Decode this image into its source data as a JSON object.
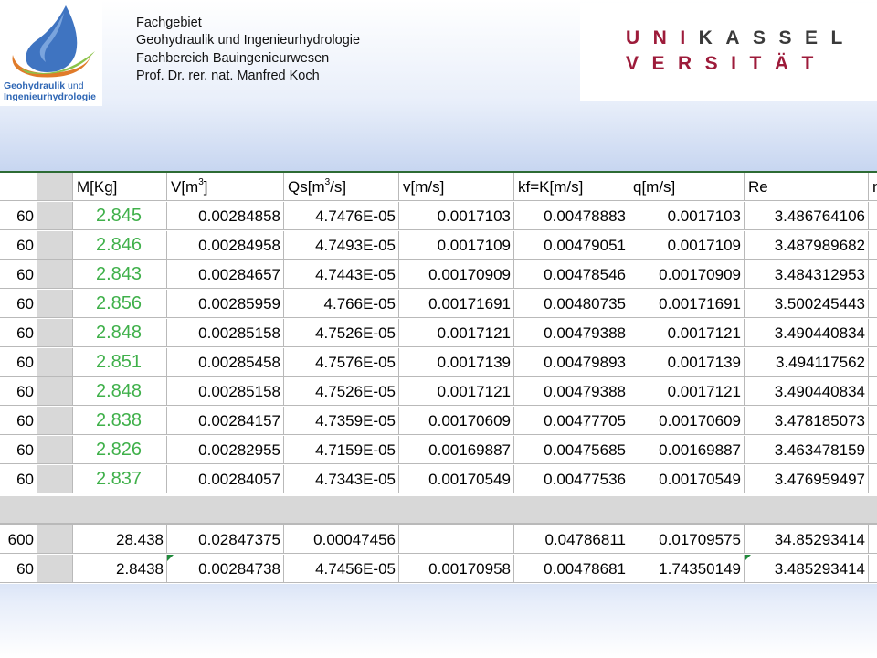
{
  "header": {
    "logo_line1": "Geohydraulik",
    "logo_line1_suffix": "und",
    "logo_line2": "Ingenieurhydrologie",
    "dept_lines": [
      "Fachgebiet",
      "Geohydraulik und Ingenieurhydrologie",
      "Fachbereich Bauingenieurwesen",
      "Prof. Dr. rer. nat. Manfred Koch"
    ],
    "uni_row1_red": "UNI",
    "uni_row1_dark": "KASSEL",
    "uni_row2_red": "VERSITÄT"
  },
  "colors": {
    "logo_blue": "#3f74c1",
    "logo_orange": "#e07b2a",
    "logo_green": "#8bc34a",
    "uni_red": "#9d1b3a",
    "value_green": "#3fb04a"
  },
  "table": {
    "headers": [
      "",
      "",
      "M[Kg]",
      "V[m",
      "]",
      "Qs[m",
      "/s]",
      "v[m/s]",
      "kf=K[m/s]",
      "q[m/s]",
      "Re",
      "n"
    ],
    "header_sup": "3",
    "rows": [
      [
        "60",
        "2.845",
        "0.00284858",
        "4.7476E-05",
        "0.0017103",
        "0.00478883",
        "0.0017103",
        "3.486764106"
      ],
      [
        "60",
        "2.846",
        "0.00284958",
        "4.7493E-05",
        "0.0017109",
        "0.00479051",
        "0.0017109",
        "3.487989682"
      ],
      [
        "60",
        "2.843",
        "0.00284657",
        "4.7443E-05",
        "0.00170909",
        "0.00478546",
        "0.00170909",
        "3.484312953"
      ],
      [
        "60",
        "2.856",
        "0.00285959",
        "4.766E-05",
        "0.00171691",
        "0.00480735",
        "0.00171691",
        "3.500245443"
      ],
      [
        "60",
        "2.848",
        "0.00285158",
        "4.7526E-05",
        "0.0017121",
        "0.00479388",
        "0.0017121",
        "3.490440834"
      ],
      [
        "60",
        "2.851",
        "0.00285458",
        "4.7576E-05",
        "0.0017139",
        "0.00479893",
        "0.0017139",
        "3.494117562"
      ],
      [
        "60",
        "2.848",
        "0.00285158",
        "4.7526E-05",
        "0.0017121",
        "0.00479388",
        "0.0017121",
        "3.490440834"
      ],
      [
        "60",
        "2.838",
        "0.00284157",
        "4.7359E-05",
        "0.00170609",
        "0.00477705",
        "0.00170609",
        "3.478185073"
      ],
      [
        "60",
        "2.826",
        "0.00282955",
        "4.7159E-05",
        "0.00169887",
        "0.00475685",
        "0.00169887",
        "3.463478159"
      ],
      [
        "60",
        "2.837",
        "0.00284057",
        "4.7343E-05",
        "0.00170549",
        "0.00477536",
        "0.00170549",
        "3.476959497"
      ]
    ],
    "summary_rows": [
      [
        "600",
        "28.438",
        "0.02847375",
        "0.00047456",
        "",
        "0.04786811",
        "0.01709575",
        "34.85293414"
      ],
      [
        "60",
        "2.8438",
        "0.00284738",
        "4.7456E-05",
        "0.00170958",
        "0.00478681",
        "1.74350149",
        "3.485293414"
      ]
    ]
  }
}
